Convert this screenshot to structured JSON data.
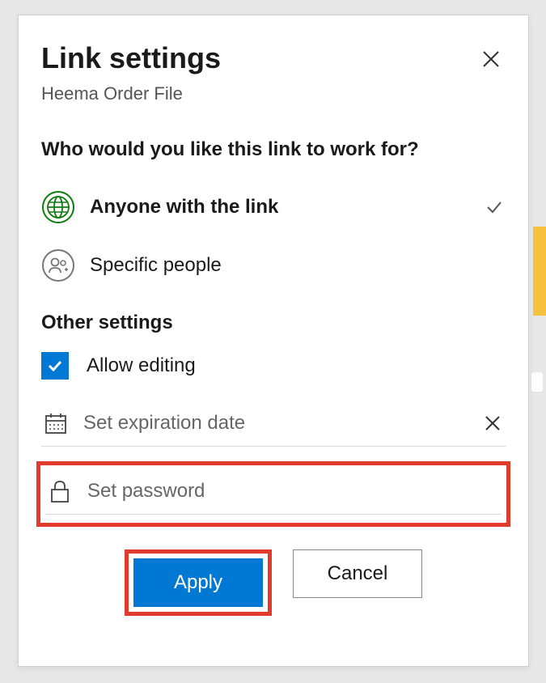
{
  "header": {
    "title": "Link settings",
    "subtitle": "Heema Order File"
  },
  "question": "Who would you like this link to work for?",
  "options": {
    "anyone": "Anyone with the link",
    "specific": "Specific people"
  },
  "other": {
    "header": "Other settings",
    "allow_editing": "Allow editing",
    "expiration_placeholder": "Set expiration date",
    "password_placeholder": "Set password"
  },
  "buttons": {
    "apply": "Apply",
    "cancel": "Cancel"
  }
}
